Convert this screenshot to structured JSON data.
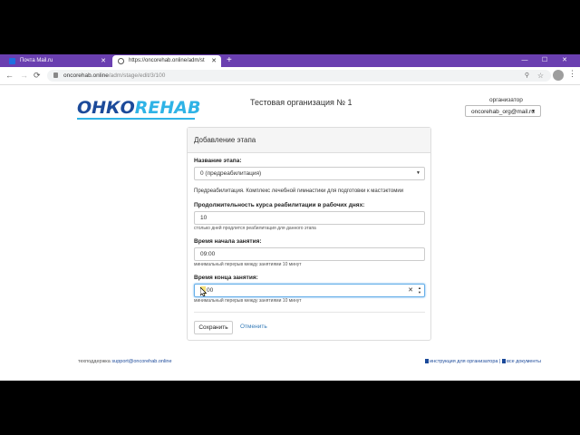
{
  "browser": {
    "tabs": [
      {
        "label": "Почта Mail.ru",
        "active": false
      },
      {
        "label": "https://oncorehab.online/adm/st",
        "active": true
      }
    ],
    "new_tab": "+",
    "window_controls": {
      "minimize": "—",
      "maximize": "☐",
      "close": "✕"
    },
    "url_host": "oncorehab.online",
    "url_path": "/adm/stage/edit/3/100",
    "back": "←",
    "forward": "→",
    "reload": "⟳"
  },
  "header": {
    "logo_part1": "ОНКО",
    "logo_part2": "REHAB",
    "org_title": "Тестовая организация № 1",
    "role_label": "организатор",
    "user": "oncorehab_org@mail.ru"
  },
  "form": {
    "title": "Добавление этапа",
    "name_label": "Название этапа:",
    "name_value": "0 (предреабилитация)",
    "description": "Предреабилитация. Комплекс лечебной гимнастики для подготовки к мастэктомии",
    "duration_label": "Продолжительность курса реабилитации в рабочих днях:",
    "duration_value": "10",
    "duration_help": "столько дней продлится реабилитация для данного этапа",
    "start_label": "Время начала занятия:",
    "start_value": "09:00",
    "start_help": "минимальный перерыв между занятиями 10 минут",
    "end_label": "Время конца занятия:",
    "end_value": "00",
    "end_help": "минимальный перерыв между занятиями 10 минут",
    "save_label": "Сохранить",
    "cancel_label": "Отменить"
  },
  "footer": {
    "support_label": "техподдержка",
    "support_email": "support@oncorehab.online",
    "link_instructions": "инструкция для организатора",
    "separator": "|",
    "link_documents": "все документы"
  },
  "colors": {
    "tabbar": "#6a3fb0",
    "logo_dark": "#1c4a9a",
    "logo_light": "#2fb3e6",
    "link": "#337ab7"
  }
}
